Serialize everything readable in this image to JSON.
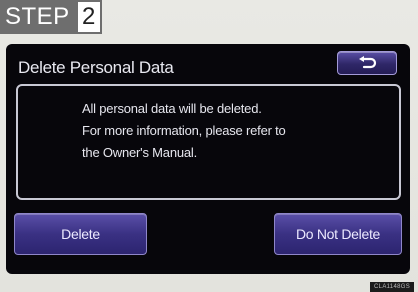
{
  "step": {
    "label": "STEP",
    "number": "2"
  },
  "dialog": {
    "title": "Delete Personal Data",
    "back_icon": "return-arrow-icon",
    "message_lines": [
      "All personal data will be deleted.",
      "For more information, please refer to",
      "the Owner's Manual."
    ],
    "delete_label": "Delete",
    "do_not_delete_label": "Do Not Delete"
  },
  "caption": "CLA1148GS",
  "colors": {
    "screen_bg": "#07060b",
    "button_purple": "#3a3183",
    "step_gray": "#6e6e6e"
  }
}
